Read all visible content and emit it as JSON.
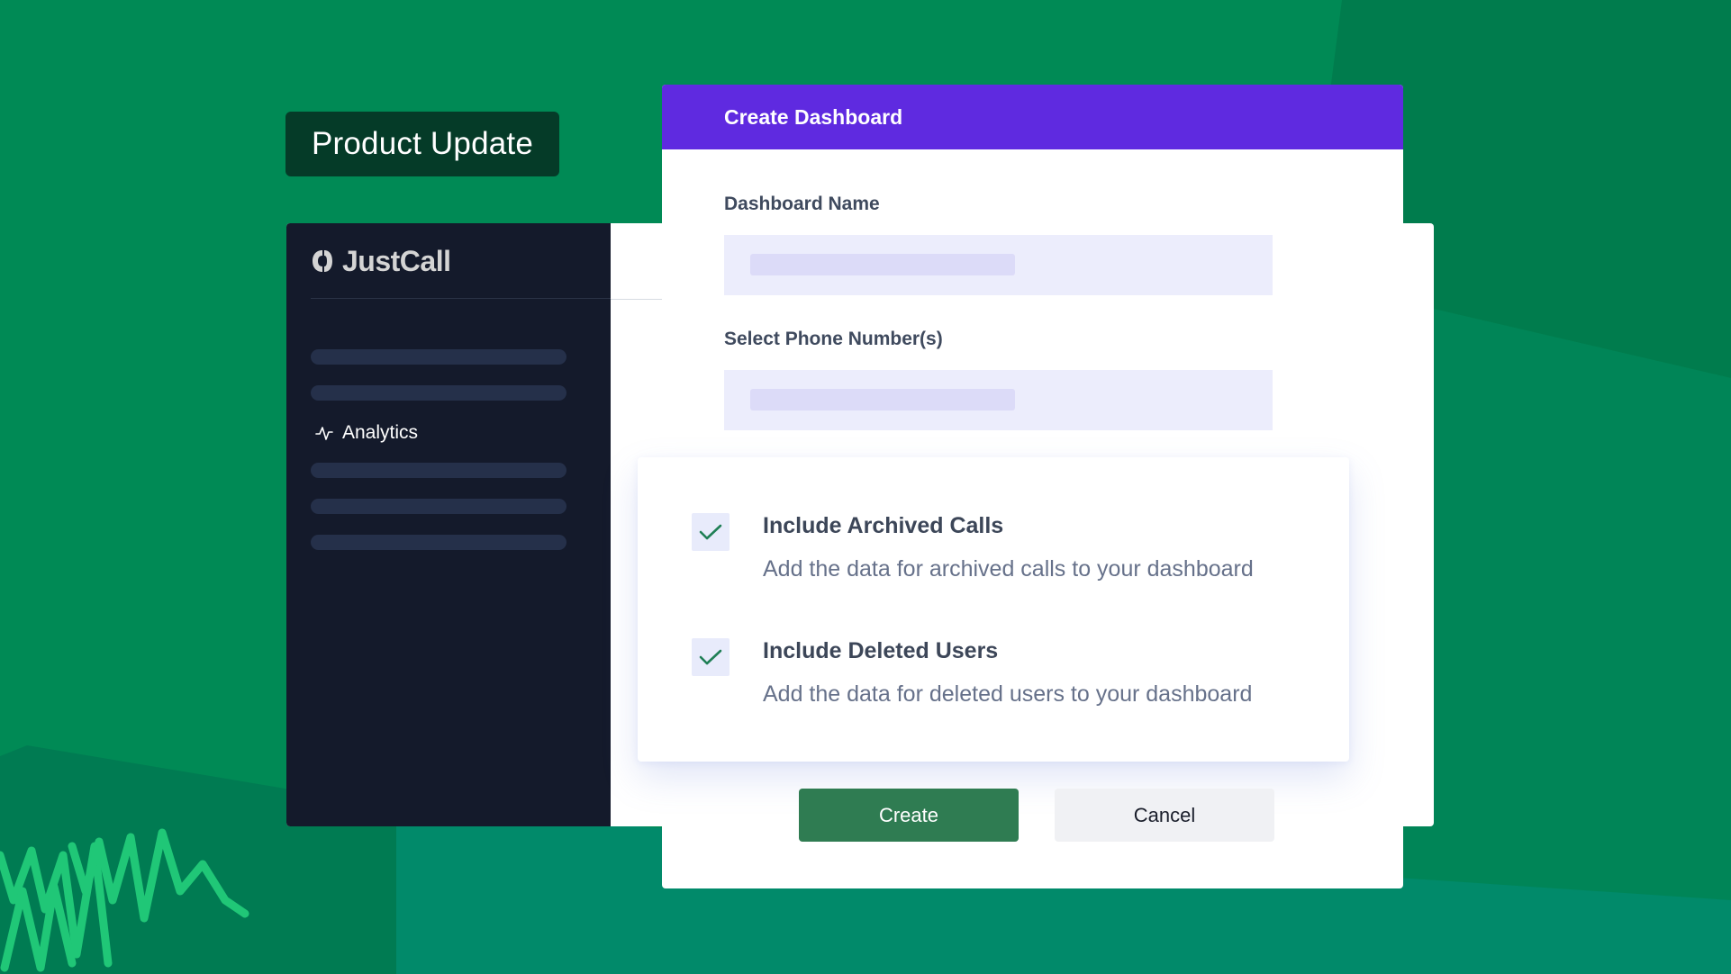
{
  "badge": {
    "label": "Product Update"
  },
  "sidebar": {
    "logo_text": "JustCall",
    "nav_item_label": "Analytics"
  },
  "modal": {
    "title": "Create Dashboard",
    "fields": [
      {
        "label": "Dashboard Name"
      },
      {
        "label": "Select Phone Number(s)"
      }
    ],
    "options": [
      {
        "title": "Include Archived Calls",
        "description": "Add the data for archived calls to your dashboard",
        "checked": true
      },
      {
        "title": "Include Deleted Users",
        "description": "Add the data for deleted users to your dashboard",
        "checked": true
      }
    ],
    "buttons": {
      "create": "Create",
      "cancel": "Cancel"
    }
  },
  "colors": {
    "background": "#008a55",
    "badge_bg": "#053b28",
    "sidebar_bg": "#141a2b",
    "modal_header": "#5f2ae0",
    "create_button": "#2f7c52",
    "check_color": "#1f7f55",
    "doodle": "#20c777"
  },
  "icons": {
    "logo": "justcall-logo-icon",
    "analytics": "activity-pulse-icon",
    "checkbox": "check-icon"
  }
}
